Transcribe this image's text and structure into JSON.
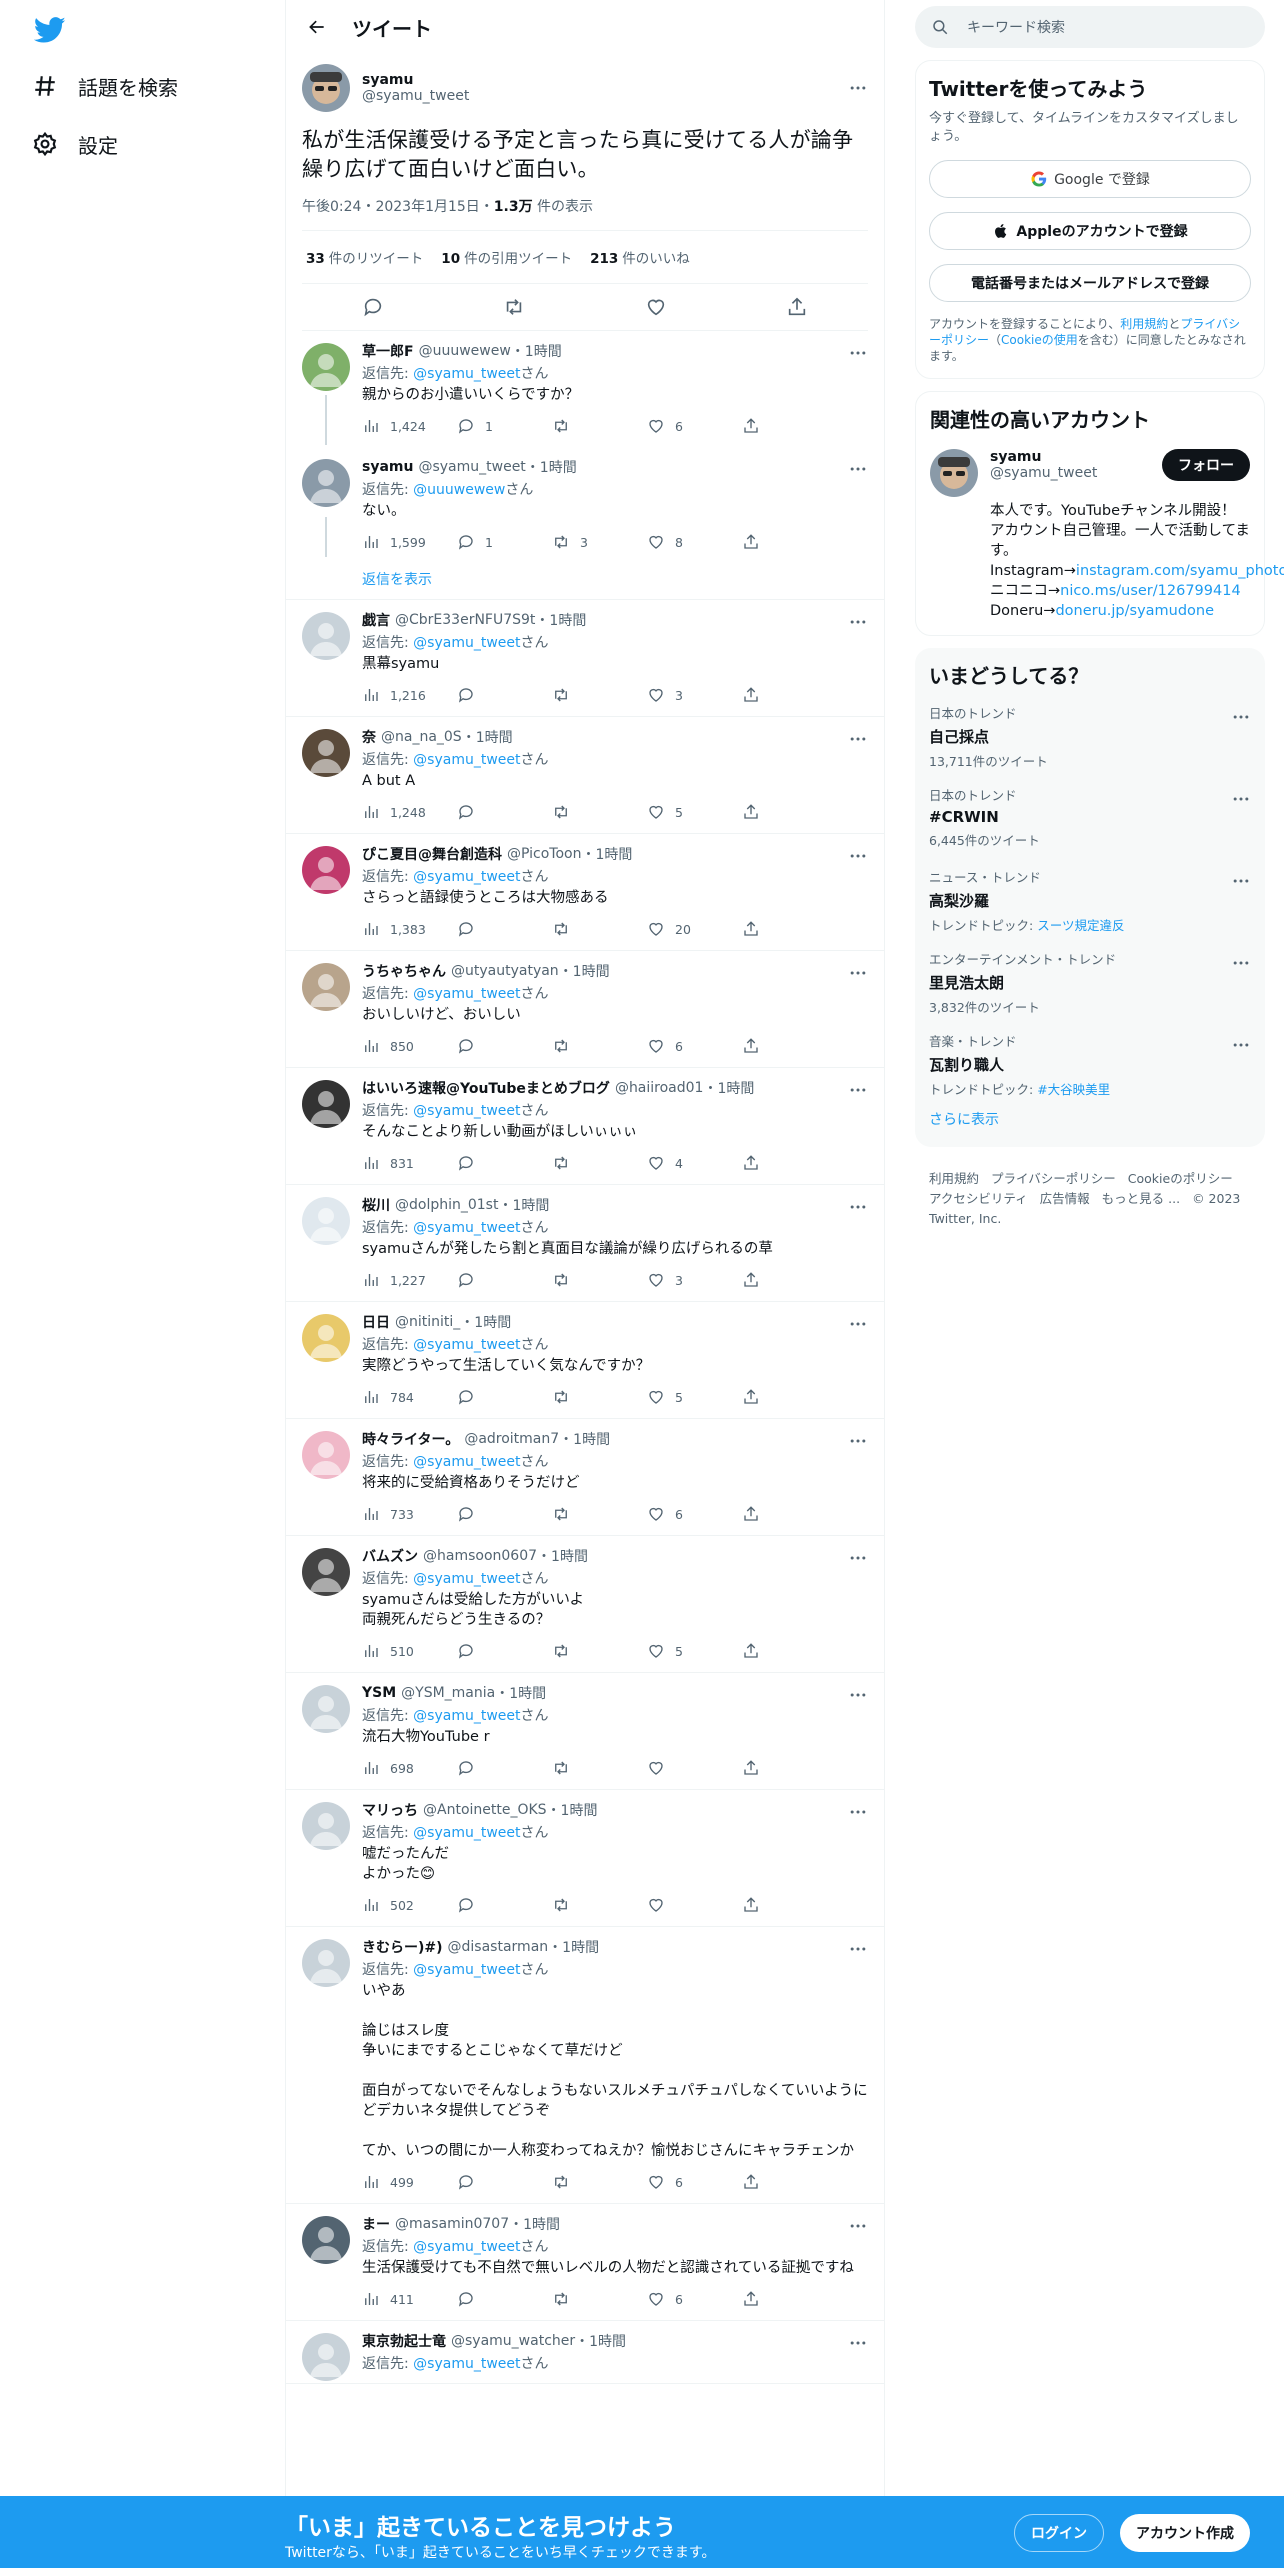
{
  "nav": {
    "explore_label": "話題を検索",
    "settings_label": "設定"
  },
  "header": {
    "title": "ツイート"
  },
  "focal": {
    "name": "syamu",
    "handle": "@syamu_tweet",
    "text": "私が生活保護受ける予定と言ったら真に受けてる人が論争繰り広げて面白いけど面白い。",
    "time": "午後0:24・2023年1月15日・",
    "views_count": "1.3万",
    "views_label": " 件の表示",
    "retweets_count": "33",
    "retweets_label": "件のリツイート",
    "quotes_count": "10",
    "quotes_label": "件の引用ツイート",
    "likes_count": "213",
    "likes_label": "件のいいね"
  },
  "thread": [
    {
      "name": "草一郎F",
      "handle": "@uuuwewew",
      "time": "・1時間",
      "replyto_prefix": "返信先: ",
      "replyto": "@syamu_tweet",
      "replyto_suffix": "さん",
      "text": "親からのお小遣いいくらですか？",
      "views": "1,424",
      "replies": "1",
      "retweets": "",
      "likes": "6"
    },
    {
      "name": "syamu",
      "handle": "@syamu_tweet",
      "time": "・1時間",
      "replyto_prefix": "返信先: ",
      "replyto": "@uuuwewew",
      "replyto_suffix": "さん",
      "text": "ない。",
      "views": "1,599",
      "replies": "1",
      "retweets": "3",
      "likes": "8"
    }
  ],
  "show_replies": "返信を表示",
  "replies": [
    {
      "name": "戯言",
      "handle": "@CbrE33erNFU7S9t",
      "time": "・1時間",
      "text": "黒幕syamu",
      "views": "1,216",
      "replies": "",
      "retweets": "",
      "likes": "3"
    },
    {
      "name": "奈",
      "handle": "@na_na_0S",
      "time": "・1時間",
      "text": "A but A",
      "views": "1,248",
      "replies": "",
      "retweets": "",
      "likes": "5"
    },
    {
      "name": "ぴこ夏目@舞台創造科",
      "handle": "@PicoToon",
      "time": "・1時間",
      "text": "さらっと語録使うところは大物感ある",
      "views": "1,383",
      "replies": "",
      "retweets": "",
      "likes": "20"
    },
    {
      "name": "うちゃちゃん",
      "handle": "@utyautyatyan",
      "time": "・1時間",
      "text": "おいしいけど、おいしい",
      "views": "850",
      "replies": "",
      "retweets": "",
      "likes": "6"
    },
    {
      "name": "はいいろ速報@YouTubeまとめブログ",
      "handle": "@haiiroad01",
      "time": "・1時間",
      "text": "そんなことより新しい動画がほしいぃぃぃ",
      "views": "831",
      "replies": "",
      "retweets": "",
      "likes": "4"
    },
    {
      "name": "桜川",
      "handle": "@dolphin_01st",
      "time": "・1時間",
      "text": "syamuさんが発したら割と真面目な議論が繰り広げられるの草",
      "views": "1,227",
      "replies": "",
      "retweets": "",
      "likes": "3"
    },
    {
      "name": "日日",
      "handle": "@nitiniti_",
      "time": "・1時間",
      "text": "実際どうやって生活していく気なんですか？",
      "views": "784",
      "replies": "",
      "retweets": "",
      "likes": "5"
    },
    {
      "name": "時々ライター。",
      "handle": "@adroitman7",
      "time": "・1時間",
      "text": "将来的に受給資格ありそうだけど",
      "views": "733",
      "replies": "",
      "retweets": "",
      "likes": "6"
    },
    {
      "name": "バムズン",
      "handle": "@hamsoon0607",
      "time": "・1時間",
      "text": "syamuさんは受給した方がいいよ\n両親死んだらどう生きるの？",
      "views": "510",
      "replies": "",
      "retweets": "",
      "likes": "5"
    },
    {
      "name": "YSM",
      "handle": "@YSM_mania",
      "time": "・1時間",
      "text": "流石大物YouTube r",
      "views": "698",
      "replies": "",
      "retweets": "",
      "likes": ""
    },
    {
      "name": "マリっち",
      "handle": "@Antoinette_OKS",
      "time": "・1時間",
      "text": "嘘だったんだ\nよかった😊",
      "views": "502",
      "replies": "",
      "retweets": "",
      "likes": ""
    },
    {
      "name": "きむらー)#)",
      "handle": "@disastarman",
      "time": "・1時間",
      "text": "いやあ\n\n論じはスレ度\n争いにまでするとこじゃなくて草だけど\n\n面白がってないでそんなしょうもないスルメチュパチュパしなくていいように\nどデカいネタ提供してどうぞ\n\nてか、いつの間にか一人称変わってねえか？愉悦おじさんにキャラチェンか",
      "views": "499",
      "replies": "",
      "retweets": "",
      "likes": "6"
    },
    {
      "name": "まー",
      "handle": "@masamin0707",
      "time": "・1時間",
      "text": "生活保護受けても不自然で無いレベルの人物だと認識されている証拠ですね",
      "views": "411",
      "replies": "",
      "retweets": "",
      "likes": "6"
    },
    {
      "name": "東京勃起士竜",
      "handle": "@syamu_watcher",
      "time": "・1時間",
      "text": "",
      "views": "",
      "replies": "",
      "retweets": "",
      "likes": ""
    }
  ],
  "reply_prefix": "返信先: ",
  "reply_target": "@syamu_tweet",
  "reply_suffix": "さん",
  "right": {
    "search_placeholder": "キーワード検索",
    "signup_title": "Twitterを使ってみよう",
    "signup_sub": "今すぐ登録して、タイムラインをカスタマイズしましょう。",
    "google_label": "Google で登録",
    "apple_label": "Appleのアカウントで登録",
    "phone_label": "電話番号またはメールアドレスで登録",
    "tos_1": "アカウントを登録することにより、",
    "tos_link1": "利用規約",
    "tos_2": "と",
    "tos_link2": "プライバシーポリシー",
    "tos_3": "（",
    "tos_link3": "Cookieの使用",
    "tos_4": "を含む）に同意したとみなされます。",
    "related_title": "関連性の高いアカウント",
    "related_name": "syamu",
    "related_handle": "@syamu_tweet",
    "follow_label": "フォロー",
    "bio_1": "本人です。YouTubeチャンネル開設！アカウント自己管理。一人で活動してます。 Instagram→",
    "bio_link1": "instagram.com/syamu_photo",
    "bio_2": " ニコニコ→",
    "bio_link2": "nico.ms/user/126799414",
    "bio_3": "Doneru→",
    "bio_link3": "doneru.jp/syamudone",
    "trends_title": "いまどうしてる？",
    "trends": [
      {
        "cat": "日本のトレンド",
        "name": "自己採点",
        "cnt": "13,711件のツイート",
        "topic_prefix": "",
        "topic": ""
      },
      {
        "cat": "日本のトレンド",
        "name": "#CRWIN",
        "cnt": "6,445件のツイート",
        "topic_prefix": "",
        "topic": ""
      },
      {
        "cat": "ニュース・トレンド",
        "name": "高梨沙羅",
        "cnt": "",
        "topic_prefix": "トレンドトピック: ",
        "topic": "スーツ規定違反"
      },
      {
        "cat": "エンターテインメント・トレンド",
        "name": "里見浩太朗",
        "cnt": "3,832件のツイート",
        "topic_prefix": "",
        "topic": ""
      },
      {
        "cat": "音楽・トレンド",
        "name": "瓦割り職人",
        "cnt": "",
        "topic_prefix": "トレンドトピック: ",
        "topic": "#大谷映美里"
      }
    ],
    "show_more": "さらに表示",
    "footer": [
      "利用規約",
      "プライバシーポリシー",
      "Cookieのポリシー",
      "アクセシビリティ",
      "広告情報",
      "もっと見る ...",
      "© 2023 Twitter, Inc."
    ]
  },
  "bottom": {
    "title": "「いま」起きていることを見つけよう",
    "sub": "Twitterなら、「いま」起きていることをいち早くチェックできます。",
    "login": "ログイン",
    "create": "アカウント作成"
  },
  "colors": {
    "accent": "#1d9bf0",
    "text": "#0f1419",
    "muted": "#536471"
  }
}
